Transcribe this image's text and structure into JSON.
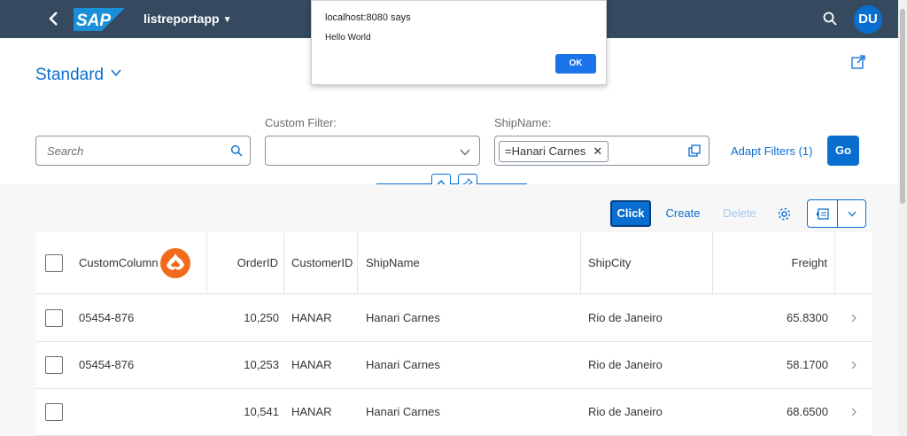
{
  "shell": {
    "logo_text": "SAP",
    "app_title": "listreportapp",
    "avatar_initials": "DU",
    "colors": {
      "shell_bg": "#354a5f",
      "accent": "#0a6ed1"
    }
  },
  "header": {
    "variant_name": "Standard",
    "search_placeholder": "Search",
    "custom_filter_label": "Custom Filter:",
    "custom_filter_value": "",
    "shipname_label": "ShipName:",
    "shipname_token": "=Hanari Carnes",
    "adapt_filters_label": "Adapt Filters (1)",
    "go_label": "Go"
  },
  "toolbar": {
    "click_label": "Click",
    "create_label": "Create",
    "delete_label": "Delete"
  },
  "table": {
    "columns": [
      "CustomColumn",
      "OrderID",
      "CustomerID",
      "ShipName",
      "ShipCity",
      "Freight"
    ],
    "rows": [
      {
        "custom": "05454-876",
        "order_id": "10,250",
        "customer_id": "HANAR",
        "ship_name": "Hanari Carnes",
        "ship_city": "Rio de Janeiro",
        "freight": "65.8300"
      },
      {
        "custom": "05454-876",
        "order_id": "10,253",
        "customer_id": "HANAR",
        "ship_name": "Hanari Carnes",
        "ship_city": "Rio de Janeiro",
        "freight": "58.1700"
      },
      {
        "custom": "",
        "order_id": "10,541",
        "customer_id": "HANAR",
        "ship_name": "Hanari Carnes",
        "ship_city": "Rio de Janeiro",
        "freight": "68.6500"
      }
    ]
  },
  "alert": {
    "title": "localhost:8080 says",
    "message": "Hello World",
    "ok_label": "OK"
  }
}
